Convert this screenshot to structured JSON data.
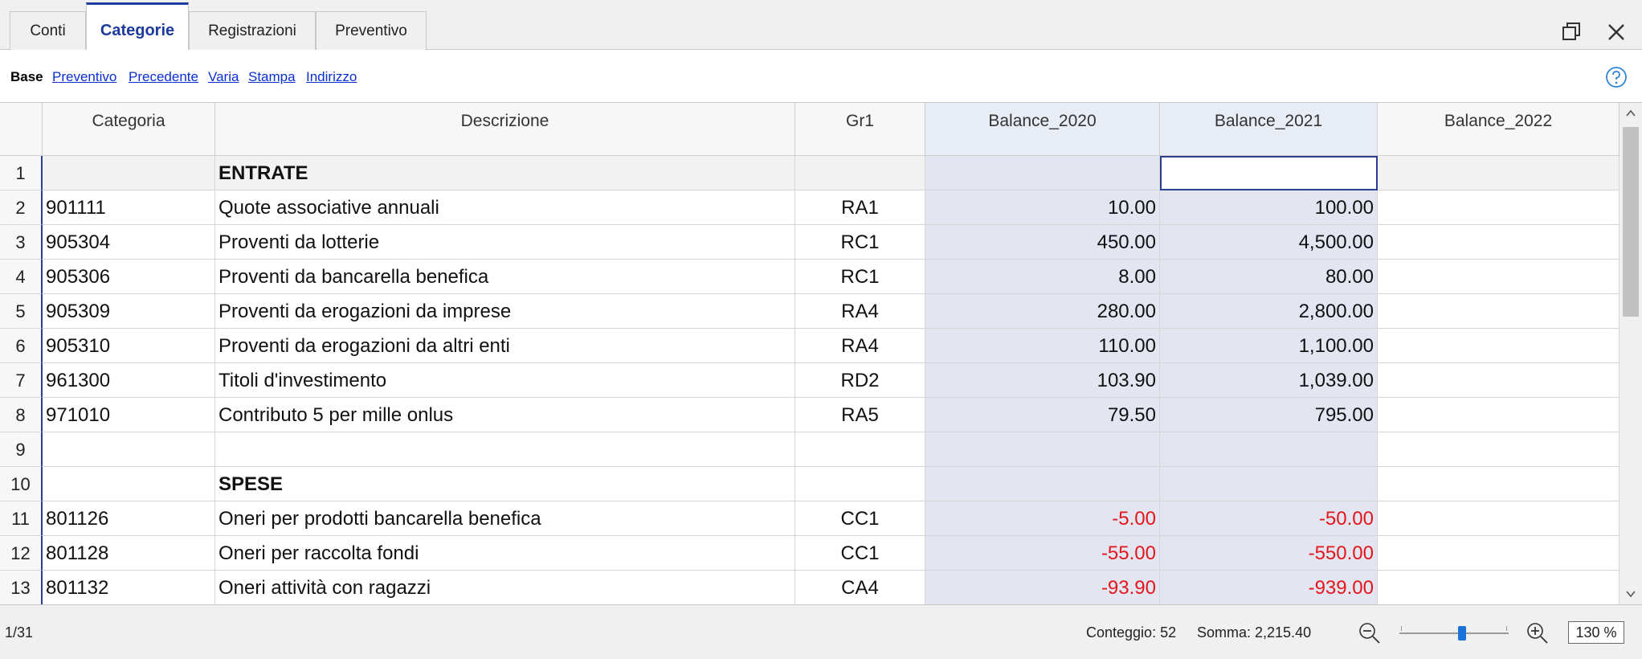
{
  "tabs": [
    {
      "label": "Conti",
      "active": false
    },
    {
      "label": "Categorie",
      "active": true
    },
    {
      "label": "Registrazioni",
      "active": false
    },
    {
      "label": "Preventivo",
      "active": false
    }
  ],
  "views": [
    {
      "label": "Base",
      "current": true
    },
    {
      "label": "Preventivo",
      "current": false
    },
    {
      "label": "Precedente",
      "current": false
    },
    {
      "label": "Varia",
      "current": false
    },
    {
      "label": "Stampa",
      "current": false
    },
    {
      "label": "Indirizzo",
      "current": false
    }
  ],
  "columns": [
    "Categoria",
    "Descrizione",
    "Gr1",
    "Balance_2020",
    "Balance_2021",
    "Balance_2022"
  ],
  "rows": [
    {
      "n": "1",
      "categoria": "",
      "descrizione": "ENTRATE",
      "gr1": "",
      "b2020": "",
      "b2021": "",
      "b2022": "",
      "bold": true
    },
    {
      "n": "2",
      "categoria": "901111",
      "descrizione": "Quote associative annuali",
      "gr1": "RA1",
      "b2020": "10.00",
      "b2021": "100.00",
      "b2022": ""
    },
    {
      "n": "3",
      "categoria": "905304",
      "descrizione": "Proventi da lotterie",
      "gr1": "RC1",
      "b2020": "450.00",
      "b2021": "4,500.00",
      "b2022": ""
    },
    {
      "n": "4",
      "categoria": "905306",
      "descrizione": "Proventi da bancarella benefica",
      "gr1": "RC1",
      "b2020": "8.00",
      "b2021": "80.00",
      "b2022": ""
    },
    {
      "n": "5",
      "categoria": "905309",
      "descrizione": "Proventi da erogazioni da imprese",
      "gr1": "RA4",
      "b2020": "280.00",
      "b2021": "2,800.00",
      "b2022": ""
    },
    {
      "n": "6",
      "categoria": "905310",
      "descrizione": "Proventi da erogazioni da altri enti",
      "gr1": "RA4",
      "b2020": "110.00",
      "b2021": "1,100.00",
      "b2022": ""
    },
    {
      "n": "7",
      "categoria": "961300",
      "descrizione": "Titoli d'investimento",
      "gr1": "RD2",
      "b2020": "103.90",
      "b2021": "1,039.00",
      "b2022": ""
    },
    {
      "n": "8",
      "categoria": "971010",
      "descrizione": "Contributo 5 per mille onlus",
      "gr1": "RA5",
      "b2020": "79.50",
      "b2021": "795.00",
      "b2022": ""
    },
    {
      "n": "9",
      "categoria": "",
      "descrizione": "",
      "gr1": "",
      "b2020": "",
      "b2021": "",
      "b2022": ""
    },
    {
      "n": "10",
      "categoria": "",
      "descrizione": "SPESE",
      "gr1": "",
      "b2020": "",
      "b2021": "",
      "b2022": "",
      "bold": true
    },
    {
      "n": "11",
      "categoria": "801126",
      "descrizione": "Oneri per prodotti bancarella benefica",
      "gr1": "CC1",
      "b2020": "-5.00",
      "b2021": "-50.00",
      "b2022": ""
    },
    {
      "n": "12",
      "categoria": "801128",
      "descrizione": "Oneri per raccolta fondi",
      "gr1": "CC1",
      "b2020": "-55.00",
      "b2021": "-550.00",
      "b2022": ""
    },
    {
      "n": "13",
      "categoria": "801132",
      "descrizione": "Oneri attività con ragazzi",
      "gr1": "CA4",
      "b2020": "-93.90",
      "b2021": "-939.00",
      "b2022": ""
    }
  ],
  "status": {
    "position": "1/31",
    "count": "Conteggio: 52",
    "sum": "Somma: 2,215.40",
    "zoom": "130 %",
    "zoom_level_percent": 58
  },
  "colors": {
    "accent": "#1f3ea0",
    "link": "#0b2fd6",
    "negative": "#e3161b",
    "balance_bg": "#e3e5f1"
  },
  "icons": [
    "restore-window-icon",
    "close-icon",
    "help-icon",
    "zoom-out-icon",
    "zoom-in-icon"
  ]
}
